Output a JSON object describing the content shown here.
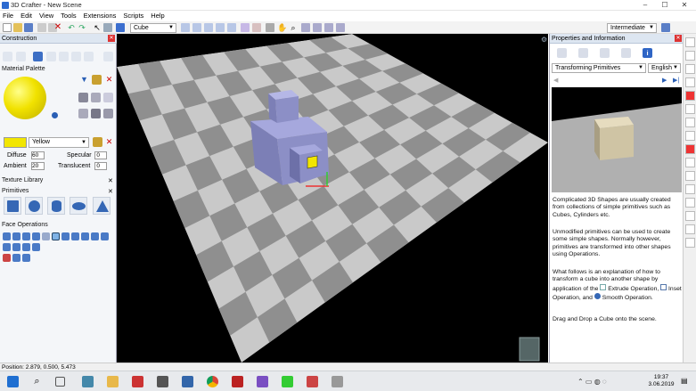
{
  "window": {
    "title": "3D Crafter - New Scene"
  },
  "menu": [
    "File",
    "Edit",
    "View",
    "Tools",
    "Extensions",
    "Scripts",
    "Help"
  ],
  "toolbar": {
    "shape_combo": "Cube",
    "level_combo": "Intermediate"
  },
  "construction": {
    "title": "Construction",
    "material_palette_label": "Material Palette",
    "color_name": "Yellow",
    "diffuse_label": "Diffuse",
    "diffuse_value": "60",
    "ambient_label": "Ambient",
    "ambient_value": "20",
    "specular_label": "Specular",
    "specular_value": "0",
    "translucent_label": "Translucent",
    "translucent_value": "0",
    "texture_library_label": "Texture Library",
    "primitives_label": "Primitives",
    "face_operations_label": "Face Operations"
  },
  "properties": {
    "title": "Properties and Information",
    "topic": "Transforming Primitives",
    "language": "English",
    "para1": "Complicated 3D Shapes are usually created from collections of simple primitives such as Cubes, Cylinders etc.",
    "para2": "Unmodified primitives can be used to create some simple shapes. Normally however, primitives are transformed into other shapes using Operations.",
    "para3a": "What follows is an explanation of how to transform a cube into another shape by application of the",
    "para3_op1": "Extrude Operation,",
    "para3_op2": "Inset Operation, and",
    "para3_op3": "Smooth Operation.",
    "para4": "Drag and Drop a Cube onto the scene."
  },
  "status": {
    "position": "Position: 2.879, 0.500, 5.473"
  },
  "taskbar": {
    "time": "19:37",
    "date": "3.06.2019"
  },
  "colors": {
    "accent_yellow": "#f2e600",
    "panel_header": "#dde6f1",
    "floor_light": "#c9c9c9",
    "floor_dark": "#8f8f8f",
    "shape": "#8c8fc6"
  },
  "icons": [
    "search-icon",
    "task-view-icon",
    "file-explorer-icon",
    "chrome-icon",
    "visual-studio-icon",
    "settings-icon"
  ]
}
